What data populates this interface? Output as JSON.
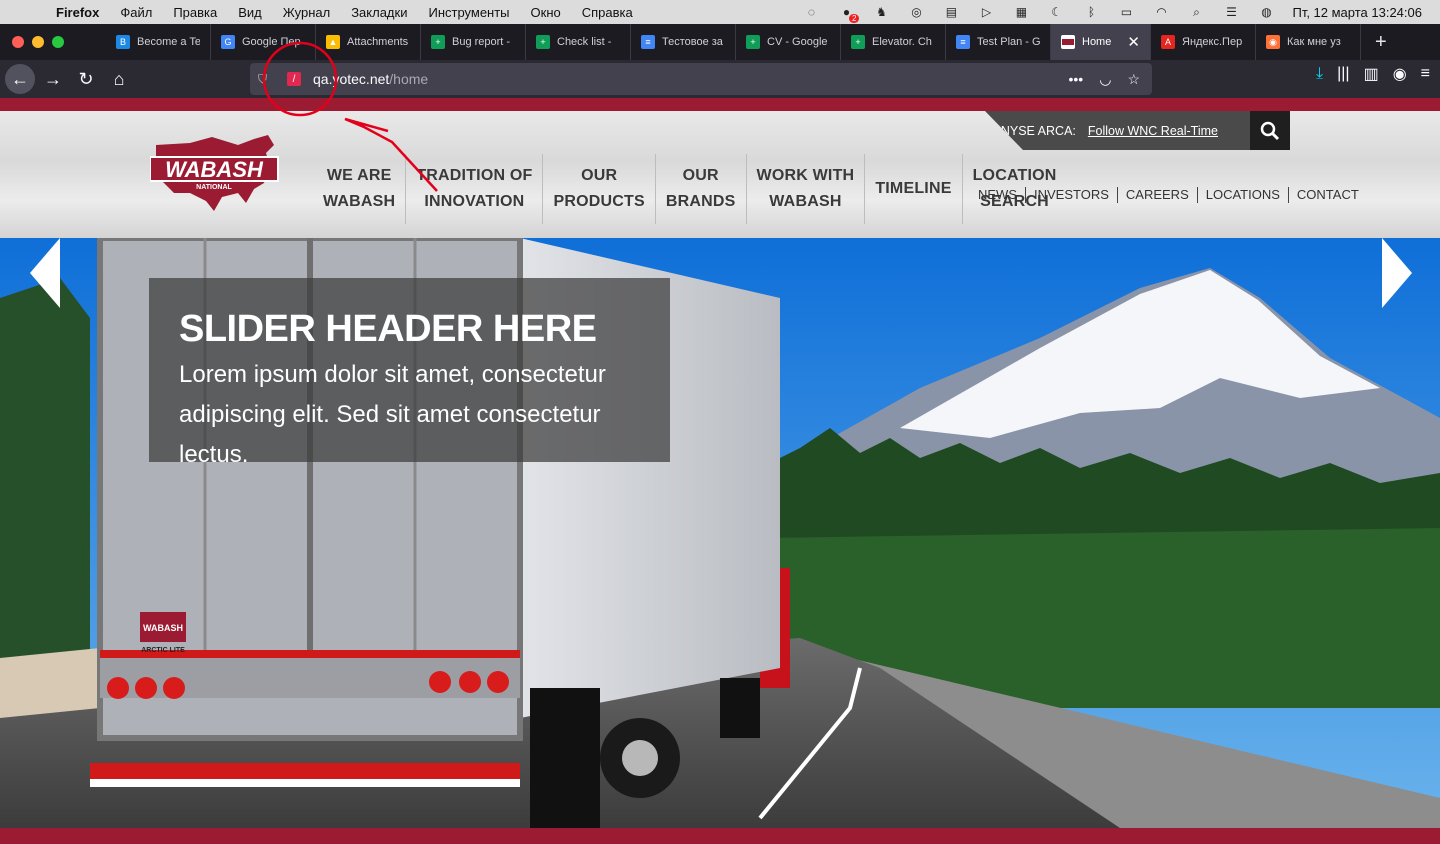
{
  "menubar": {
    "app": "Firefox",
    "items": [
      "Файл",
      "Правка",
      "Вид",
      "Журнал",
      "Закладки",
      "Инструменты",
      "Окно",
      "Справка"
    ],
    "clock": "Пт, 12 марта  13:24:06",
    "badge": "2"
  },
  "tabs": [
    {
      "title": "Become a Te",
      "color": "#1e88e5",
      "icon": "B"
    },
    {
      "title": "Google Пер",
      "color": "#4285f4",
      "icon": "G"
    },
    {
      "title": "Attachments",
      "color": "#fbbc04",
      "icon": "▲"
    },
    {
      "title": "Bug report -",
      "color": "#0f9d58",
      "icon": "+"
    },
    {
      "title": "Check list -",
      "color": "#0f9d58",
      "icon": "+"
    },
    {
      "title": "Тестовое за",
      "color": "#4285f4",
      "icon": "≡"
    },
    {
      "title": "CV - Google",
      "color": "#0f9d58",
      "icon": "+"
    },
    {
      "title": "Elevator. Ch",
      "color": "#0f9d58",
      "icon": "+"
    },
    {
      "title": "Test Plan - G",
      "color": "#4285f4",
      "icon": "≡"
    }
  ],
  "active_tab": {
    "title": "Home"
  },
  "tabs_after": [
    {
      "title": "Яндекс.Пер",
      "color": "#e52620",
      "icon": "A"
    },
    {
      "title": "Как мне уз",
      "color": "#ff7139",
      "icon": "◉"
    }
  ],
  "url": {
    "host": "qa.yotec.net",
    "path": "/home"
  },
  "site": {
    "logo_text": "WABASH",
    "logo_sub": "NATIONAL",
    "nav": [
      "WE ARE\nWABASH",
      "TRADITION OF\nINNOVATION",
      "OUR\nPRODUCTS",
      "OUR\nBRANDS",
      "WORK WITH\nWABASH",
      "TIMELINE",
      "LOCATION\nSEARCH"
    ],
    "nyse_label": "NYSE ARCA:",
    "nyse_link": "Follow WNC Real-Time",
    "util_nav": [
      "NEWS",
      "INVESTORS",
      "CAREERS",
      "LOCATIONS",
      "CONTACT"
    ],
    "slider": {
      "header": "SLIDER HEADER HERE",
      "text": "Lorem ipsum dolor sit amet, consectetur adipiscing elit. Sed sit amet consectetur lectus."
    },
    "truck_badge": "WABASH",
    "truck_model": "ARCTIC LITE"
  },
  "colors": {
    "brand": "#9b1b32",
    "annotation": "#e3001b"
  }
}
